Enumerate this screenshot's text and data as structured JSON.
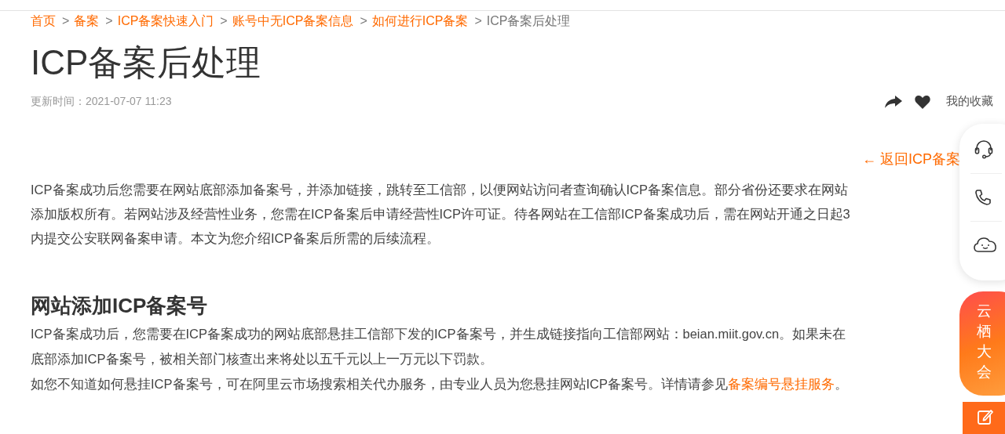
{
  "breadcrumb": [
    {
      "label": "首页",
      "link": true
    },
    {
      "label": "备案",
      "link": true
    },
    {
      "label": "ICP备案快速入门",
      "link": true
    },
    {
      "label": "账号中无ICP备案信息",
      "link": true
    },
    {
      "label": "如何进行ICP备案",
      "link": true
    },
    {
      "label": "ICP备案后处理",
      "link": false
    }
  ],
  "breadcrumb_separator": ">",
  "title": "ICP备案后处理",
  "updated": "更新时间：2021-07-07 11:23",
  "favorites_label": "我的收藏",
  "back_link": "← 返回ICP备案",
  "intro_lines": [
    "ICP备案成功后您需要在网站底部添加备案号，并添加链接，跳转至工信部，以便网站访问者查询确认ICP备案信息。部分省份还要求在网站",
    "添加版权所有。若网站涉及经营性业务，您需在ICP备案后申请经营性ICP许可证。待各网站在工信部ICP备案成功后，需在网站开通之日起3",
    "内提交公安联网备案申请。本文为您介绍ICP备案后所需的后续流程。"
  ],
  "section": {
    "heading": "网站添加ICP备案号",
    "lines": [
      "ICP备案成功后，您需要在ICP备案成功的网站底部悬挂工信部下发的ICP备案号，并生成链接指向工信部网站：beian.miit.gov.cn。如果未在",
      "底部添加ICP备案号，被相关部门核查出来将处以五千元以上一万元以下罚款。"
    ],
    "last_line": {
      "text": "如您不知道如何悬挂ICP备案号，可在阿里云市场搜索相关代办服务，由专业人员为您悬挂网站ICP备案号。详情请参见",
      "link": "备案编号悬挂服务",
      "end": "。"
    }
  },
  "event_badge": "云栖大会"
}
